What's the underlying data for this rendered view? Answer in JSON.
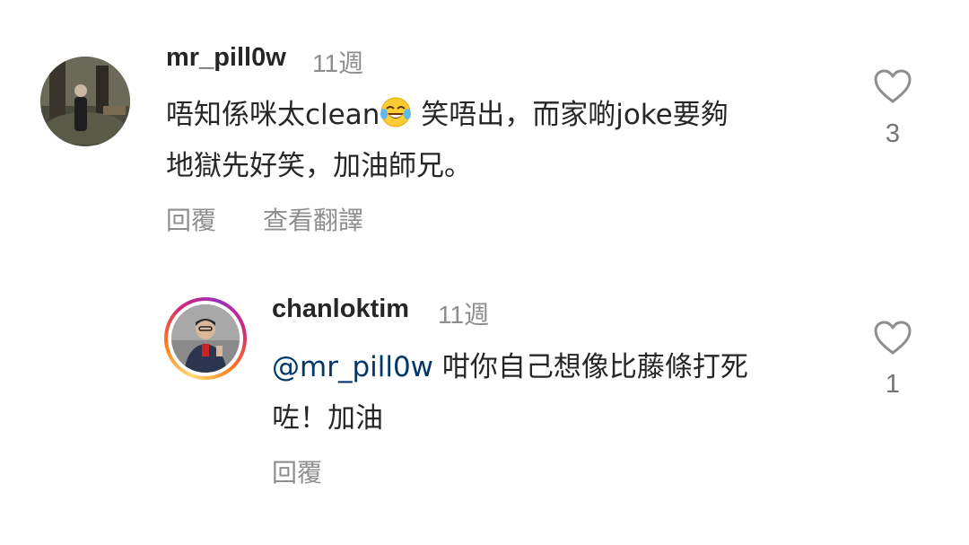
{
  "comments": [
    {
      "username": "mr_pill0w",
      "timestamp": "11週",
      "text_before_emoji": "唔知係咪太clean",
      "emoji": "face-with-tears-of-joy-icon",
      "text_after_emoji": " 笑唔出，而家啲joke要夠",
      "text_line2": "地獄先好笑，加油師兄。",
      "reply_label": "回覆",
      "translate_label": "查看翻譯",
      "like_count": "3"
    },
    {
      "username": "chanloktim",
      "timestamp": "11週",
      "mention": "@mr_pill0w",
      "text_line1": " 咁你自己想像比藤條打死",
      "text_line2": "咗！加油",
      "reply_label": "回覆",
      "like_count": "1",
      "has_story_ring": true
    }
  ],
  "colors": {
    "text": "#262626",
    "secondary": "#8e8e8e",
    "mention": "#00376b"
  }
}
